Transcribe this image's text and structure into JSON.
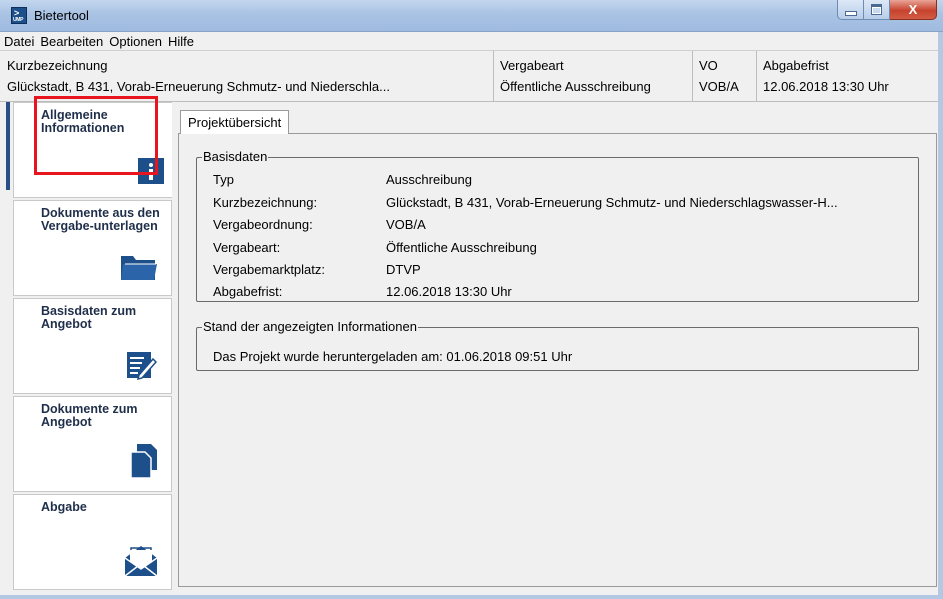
{
  "window": {
    "title": "Bietertool",
    "app_icon": "umwelt-app-icon",
    "icon_arrow": ">",
    "icon_sub": "UMP",
    "close_glyph": "X"
  },
  "menu": [
    "Datei",
    "Bearbeiten",
    "Optionen",
    "Hilfe"
  ],
  "header": {
    "kurz_label": "Kurzbezeichnung",
    "kurz_value": "Glückstadt, B 431, Vorab-Erneuerung Schmutz- und Niederschla...",
    "vergabeart_label": "Vergabeart",
    "vergabeart_value": "Öffentliche Ausschreibung",
    "vo_label": "VO",
    "vo_value": "VOB/A",
    "abgabefrist_label": "Abgabefrist",
    "abgabefrist_value": "12.06.2018 13:30 Uhr"
  },
  "nav": [
    {
      "label": "Allgemeine Informationen",
      "icon": "info-icon",
      "active": true
    },
    {
      "label": "Dokumente aus den Vergabe-unterlagen",
      "icon": "folder-icon",
      "active": false
    },
    {
      "label": "Basisdaten zum Angebot",
      "icon": "edit-form-icon",
      "active": false
    },
    {
      "label": "Dokumente zum Angebot",
      "icon": "documents-icon",
      "active": false
    },
    {
      "label": "Abgabe",
      "icon": "envelope-icon",
      "active": false
    }
  ],
  "tab": {
    "label": "Projektübersicht"
  },
  "basisdaten": {
    "title": "Basisdaten",
    "rows": [
      {
        "label": "Typ",
        "value": "Ausschreibung"
      },
      {
        "label": "Kurzbezeichnung:",
        "value": "Glückstadt, B 431, Vorab-Erneuerung Schmutz- und Niederschlagswasser-H..."
      },
      {
        "label": "Vergabeordnung:",
        "value": "VOB/A"
      },
      {
        "label": "Vergabeart:",
        "value": "Öffentliche Ausschreibung"
      },
      {
        "label": "Vergabemarktplatz:",
        "value": "DTVP"
      },
      {
        "label": "Abgabefrist:",
        "value": "12.06.2018 13:30 Uhr"
      }
    ]
  },
  "stand": {
    "title": "Stand der angezeigten Informationen",
    "text": "Das Projekt wurde heruntergeladen am: 01.06.2018 09:51 Uhr"
  },
  "colors": {
    "titlebar": "#a9c3e4",
    "nav_label": "#1f2f4a",
    "selection_frame": "#e8141e",
    "icon_fill": "#1d4f8a"
  }
}
